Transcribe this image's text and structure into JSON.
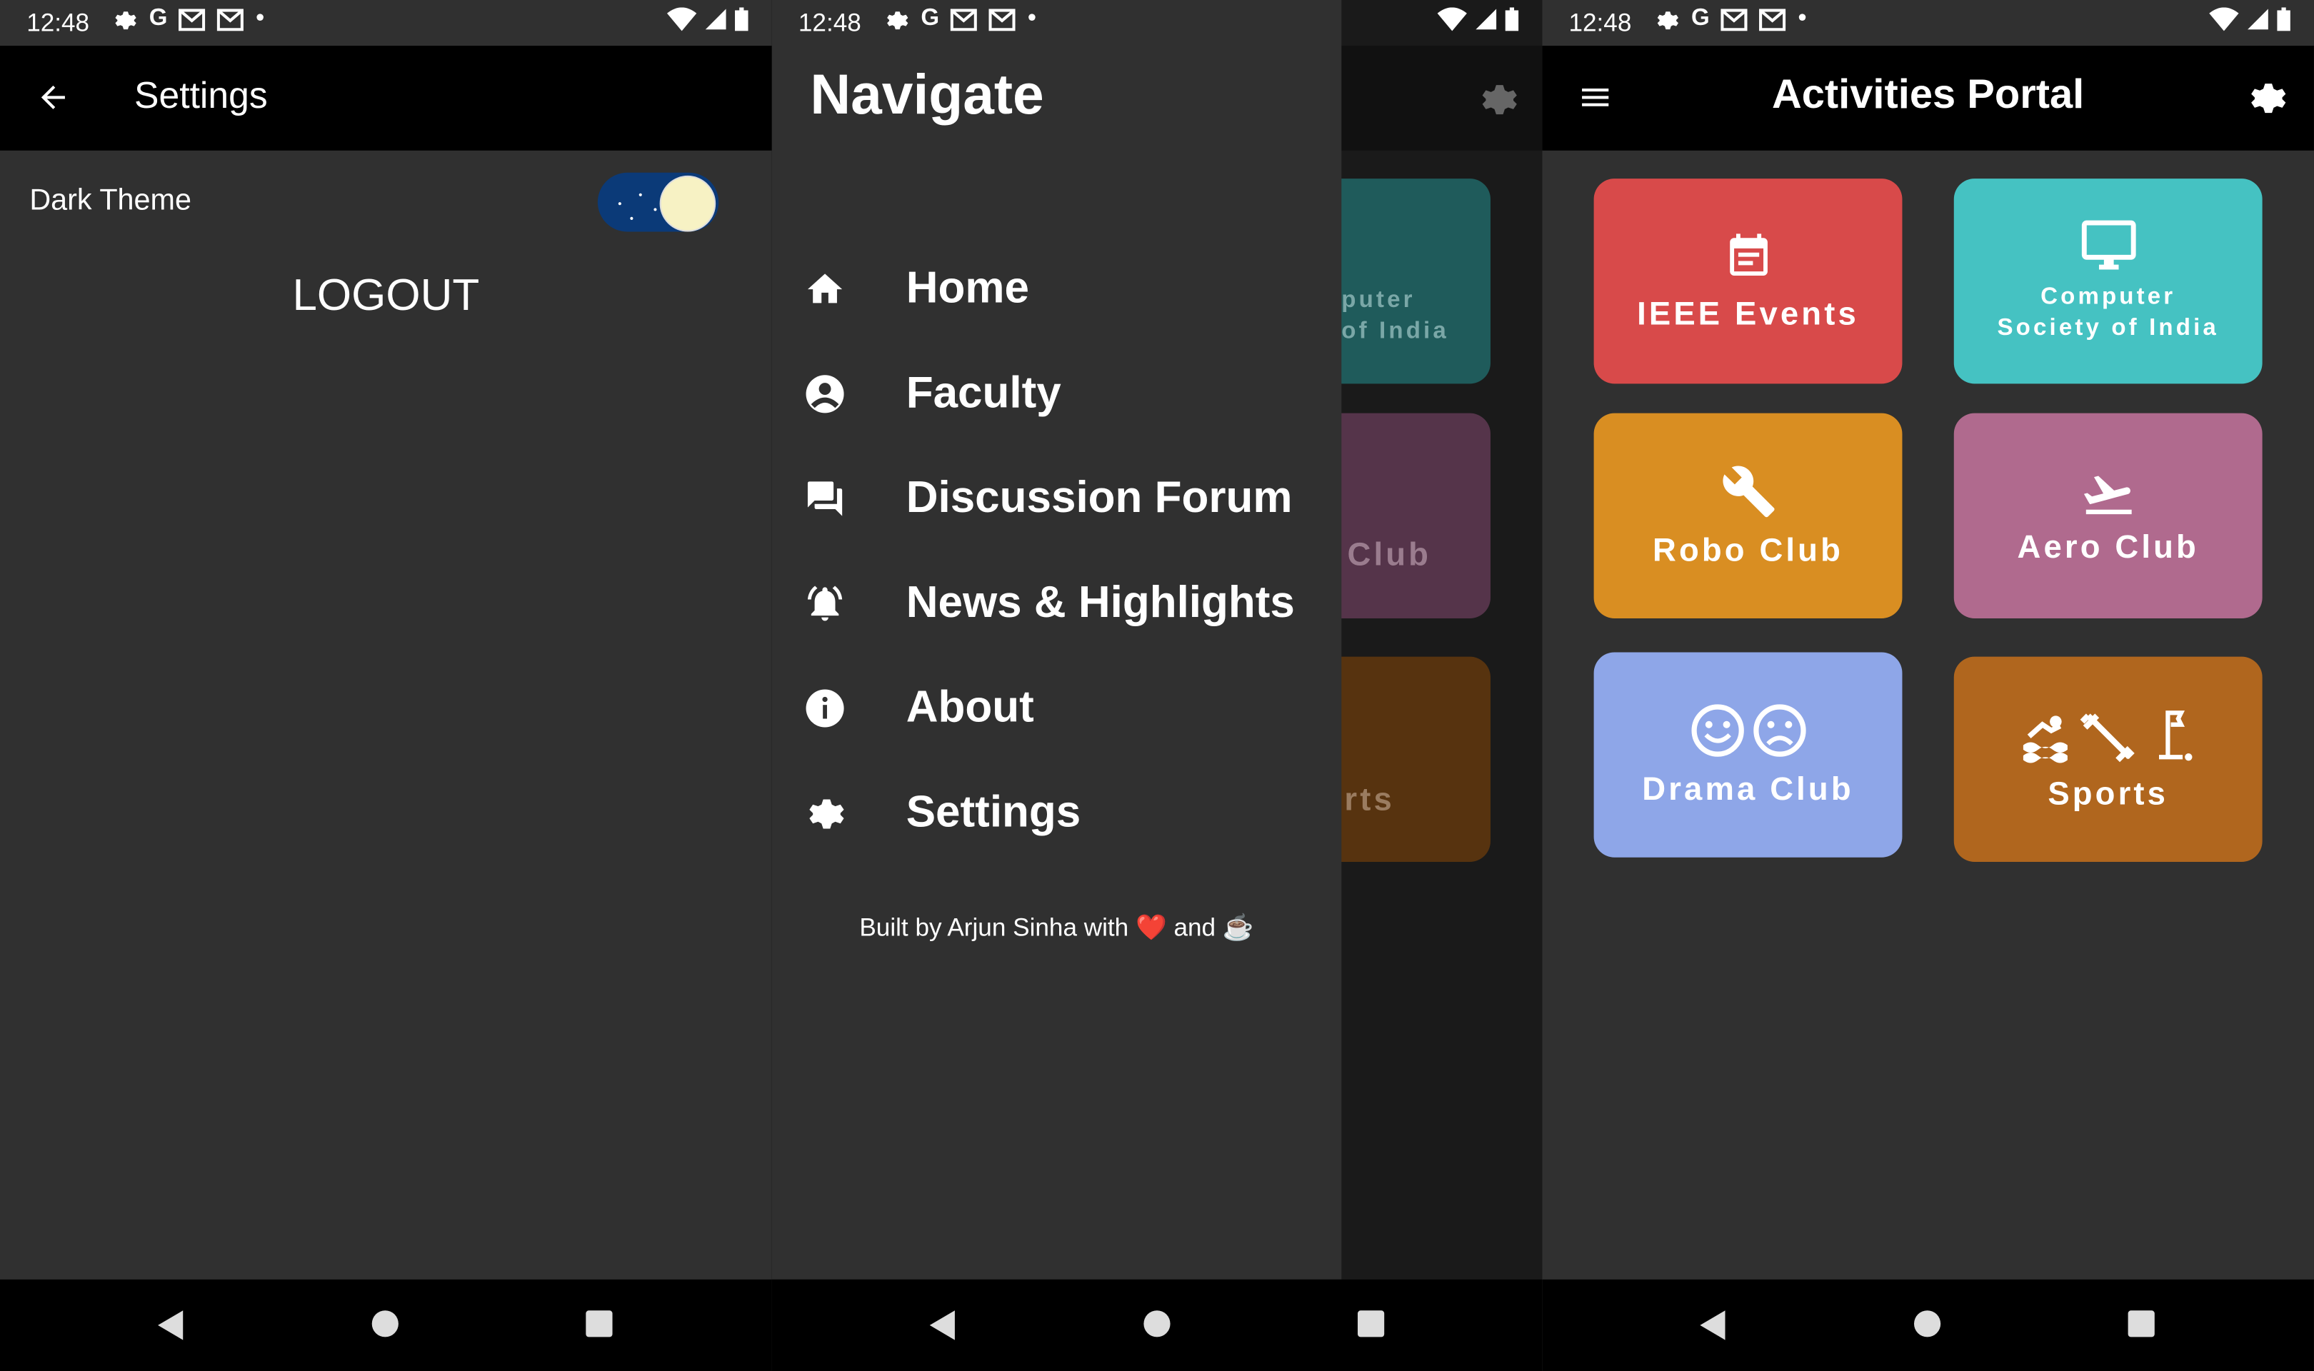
{
  "status_bar": {
    "time": "12:48"
  },
  "settings_screen": {
    "title": "Settings",
    "dark_theme_label": "Dark Theme",
    "dark_theme_on": true,
    "logout_label": "LOGOUT"
  },
  "drawer": {
    "title": "Navigate",
    "items": [
      {
        "label": "Home",
        "icon": "home-icon"
      },
      {
        "label": "Faculty",
        "icon": "account-circle-icon"
      },
      {
        "label": "Discussion Forum",
        "icon": "forum-icon"
      },
      {
        "label": "News & Highlights",
        "icon": "notifications-active-icon"
      },
      {
        "label": "About",
        "icon": "info-icon"
      },
      {
        "label": "Settings",
        "icon": "gear-icon"
      }
    ],
    "credit": "Built by Arjun Sinha with ❤️ and ☕"
  },
  "behind_tiles": {
    "csi_line1": "puter",
    "csi_line2": "of India",
    "aero": "Club",
    "sports": "rts"
  },
  "portal": {
    "title": "Activities Portal",
    "tiles": [
      {
        "label": "IEEE Events",
        "icon": "calendar-icon",
        "color": "#d84a4a"
      },
      {
        "label_line1": "Computer",
        "label_line2": "Society of India",
        "icon": "monitor-icon",
        "color": "#45c2c2"
      },
      {
        "label": "Robo Club",
        "icon": "wrench-icon",
        "color": "#d98e22"
      },
      {
        "label": "Aero Club",
        "icon": "plane-icon",
        "color": "#b06a8e"
      },
      {
        "label": "Drama Club",
        "icon": "smiley-faces-icon",
        "color": "#8ea6e8"
      },
      {
        "label": "Sports",
        "icon": "sports-icons",
        "color": "#b0661e"
      }
    ]
  },
  "colors": {
    "background": "#303030",
    "appbar": "#000000",
    "toggle_track": "#0b3a78"
  }
}
